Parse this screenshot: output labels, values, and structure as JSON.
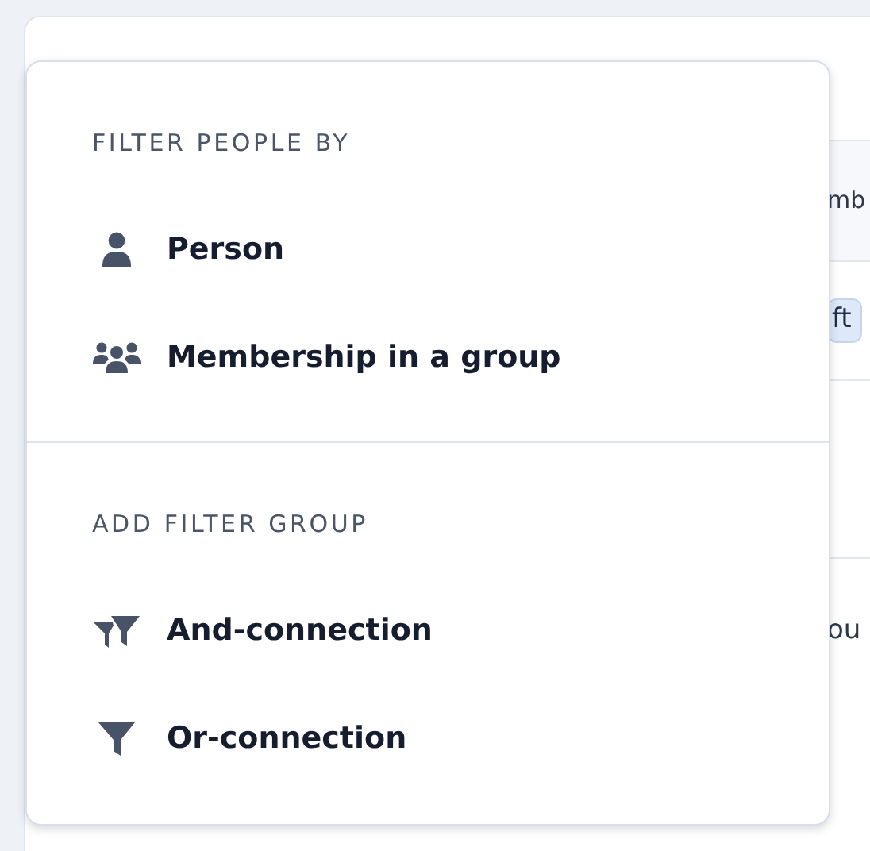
{
  "background": {
    "header_text": "mb",
    "badge": "ft",
    "row_text": "ou"
  },
  "menu": {
    "sections": [
      {
        "heading": "FILTER PEOPLE BY",
        "items": [
          {
            "label": "Person"
          },
          {
            "label": "Membership in a group"
          }
        ]
      },
      {
        "heading": "ADD FILTER GROUP",
        "items": [
          {
            "label": "And-connection"
          },
          {
            "label": "Or-connection"
          }
        ]
      }
    ]
  }
}
